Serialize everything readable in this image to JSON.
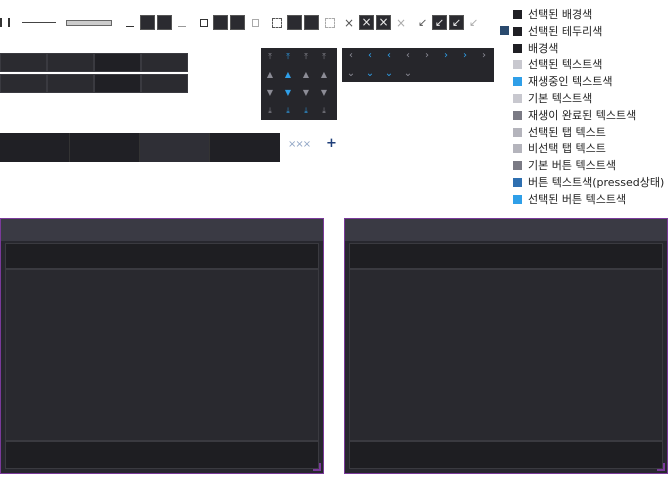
{
  "legend": [
    {
      "label": "선택된 배경색",
      "color": "#1f1f24"
    },
    {
      "label": "선택된 테두리색",
      "color": "#1f1f24"
    },
    {
      "label": "배경색",
      "color": "#1f1f24"
    },
    {
      "label": "선택된 텍스트색",
      "color": "#c8c8cf"
    },
    {
      "label": "재생중인 텍스트색",
      "color": "#2f9fe8"
    },
    {
      "label": "기본 텍스트색",
      "color": "#c8c8cf"
    },
    {
      "label": "재생이 완료된 텍스트색",
      "color": "#7a7a84"
    },
    {
      "label": "선택된 탭 텍스트",
      "color": "#b4b4bc"
    },
    {
      "label": "비선택 탭 텍스트",
      "color": "#b4b4bc"
    },
    {
      "label": "기본 버튼 텍스트색",
      "color": "#7a7a84"
    },
    {
      "label": "버튼 텍스트색(pressed상태)",
      "color": "#2e6fb0"
    },
    {
      "label": "선택된 버튼 텍스트색",
      "color": "#2f9fe8"
    }
  ],
  "extra_border_swatch": "#2a4a6e",
  "close_row": "×××",
  "plus": "+",
  "colors": {
    "accent": "#2f9fe8",
    "panel_border": "#7a3a9a",
    "dark": "#2b2b30"
  }
}
